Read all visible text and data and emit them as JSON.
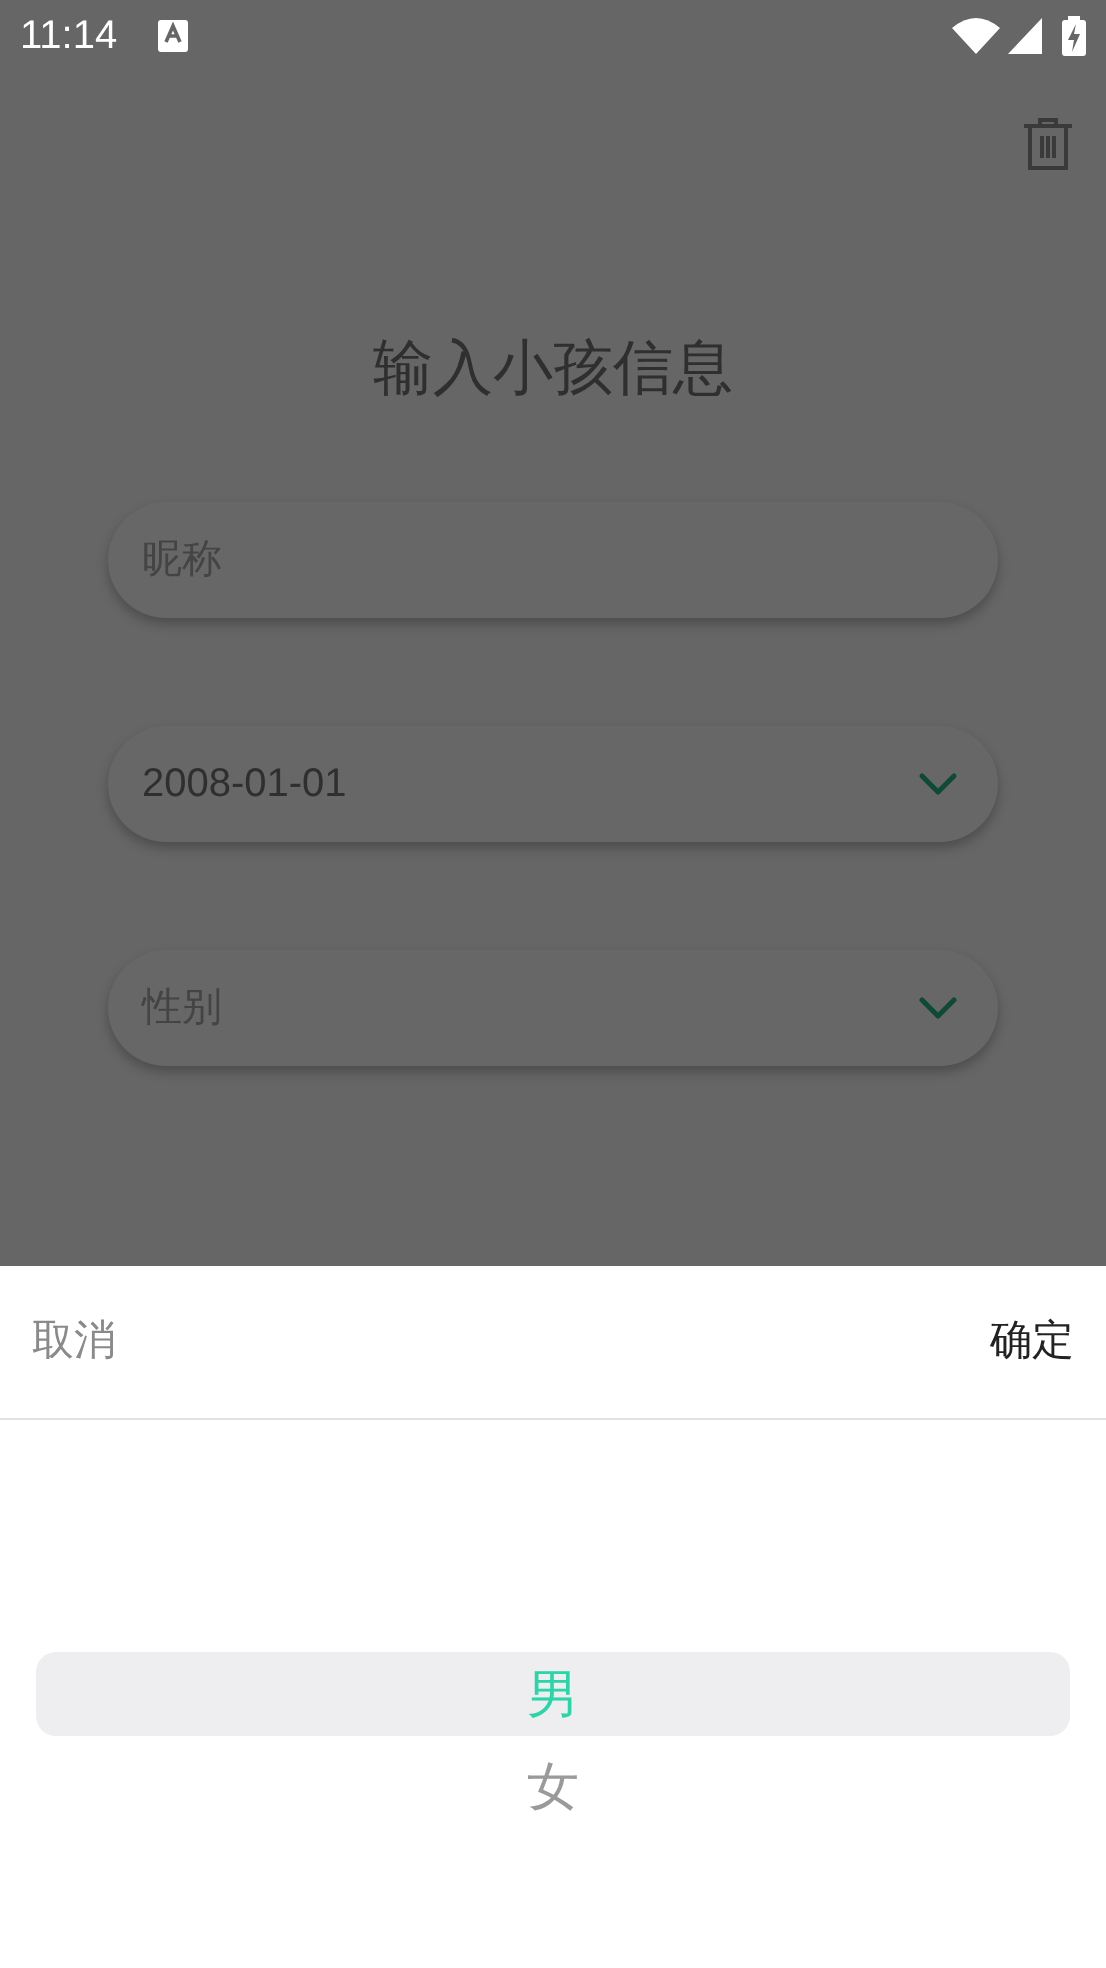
{
  "status_bar": {
    "time": "11:14"
  },
  "title": "输入小孩信息",
  "fields": [
    {
      "kind": "text",
      "placeholder": "昵称"
    },
    {
      "kind": "dropdown",
      "value": "2008-01-01"
    },
    {
      "kind": "dropdown",
      "placeholder": "性别"
    }
  ],
  "sheet": {
    "cancel": "取消",
    "confirm": "确定",
    "options": [
      {
        "label": "男",
        "selected": true
      },
      {
        "label": "女",
        "selected": false
      }
    ]
  }
}
